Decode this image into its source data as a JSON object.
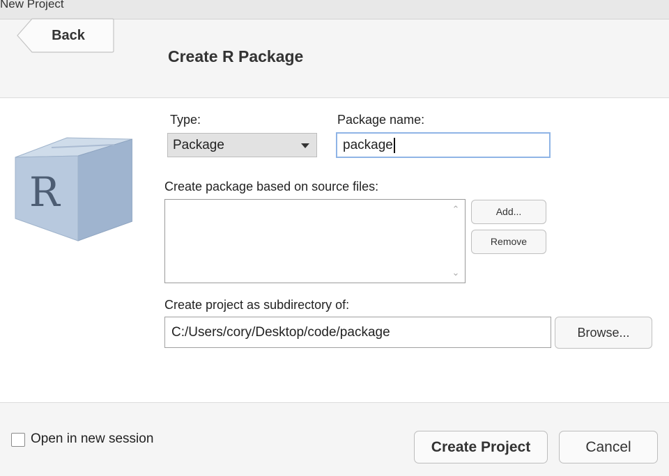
{
  "window": {
    "title": "New Project"
  },
  "header": {
    "back_label": "Back",
    "title": "Create R Package"
  },
  "logo": {
    "letter": "R",
    "icon": "r-package-cube-icon"
  },
  "form": {
    "type_label": "Type:",
    "type_value": "Package",
    "package_name_label": "Package name:",
    "package_name_value": "package",
    "source_files_label": "Create package based on source files:",
    "add_label": "Add...",
    "remove_label": "Remove",
    "subdir_label": "Create project as subdirectory of:",
    "subdir_value": "C:/Users/cory/Desktop/code/package",
    "browse_label": "Browse..."
  },
  "footer": {
    "open_new_session_label": "Open in new session",
    "open_new_session_checked": false,
    "create_label": "Create Project",
    "cancel_label": "Cancel"
  },
  "colors": {
    "focus_border": "#8fb4e6",
    "cube_face": "#b8c9de"
  }
}
